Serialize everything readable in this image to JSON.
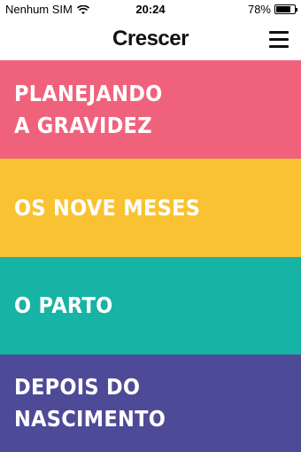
{
  "status_bar": {
    "carrier": "Nenhum SIM",
    "time": "20:24",
    "battery_percent": "78%",
    "battery_level": 0.78
  },
  "header": {
    "title": "Crescer",
    "menu_icon": "hamburger-menu-icon"
  },
  "sections": [
    {
      "label": "PLANEJANDO\nA GRAVIDEZ",
      "color": "#f0627c"
    },
    {
      "label": "OS NOVE MESES",
      "color": "#f8c232"
    },
    {
      "label": "O PARTO",
      "color": "#17b3a5"
    },
    {
      "label": "DEPOIS DO\nNASCIMENTO",
      "color": "#4d4a97"
    }
  ]
}
